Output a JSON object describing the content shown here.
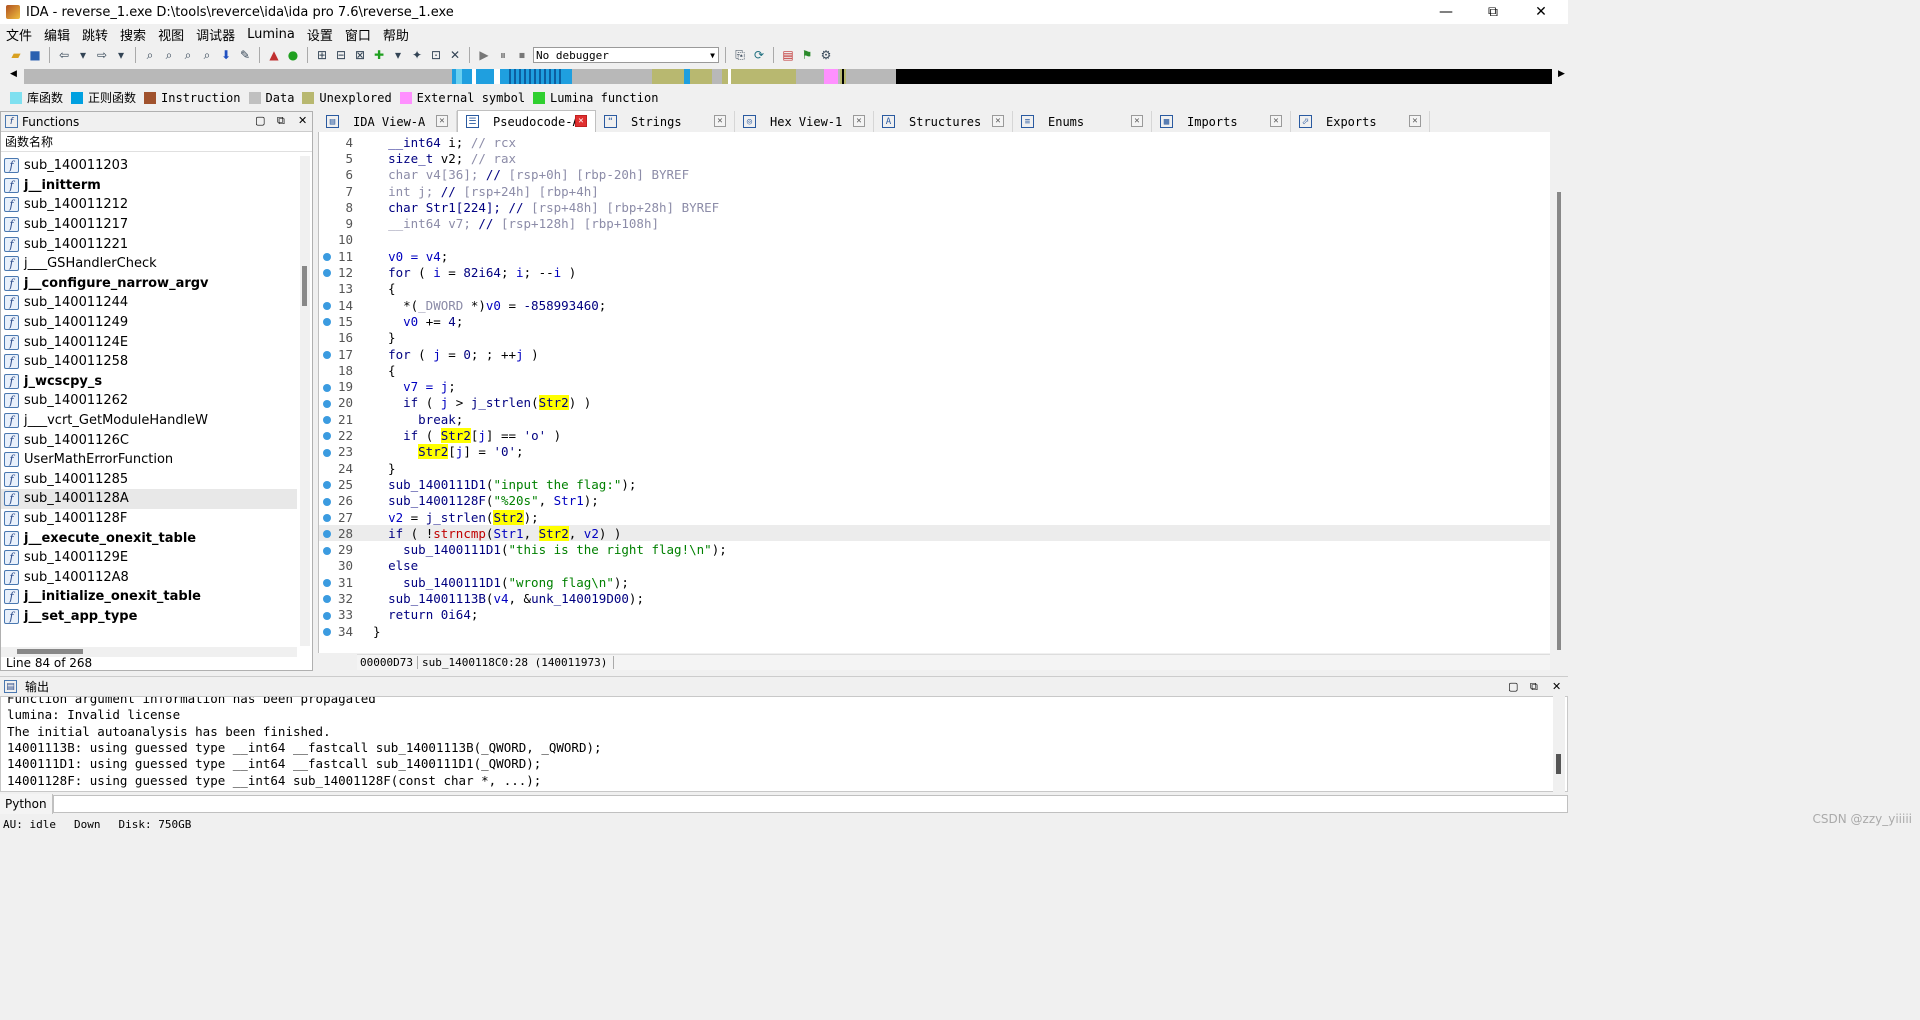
{
  "window": {
    "title": "IDA - reverse_1.exe D:\\tools\\reverce\\ida\\ida pro 7.6\\reverse_1.exe",
    "minimize": "—",
    "maximize": "⧉",
    "close": "✕"
  },
  "menu": [
    "文件",
    "编辑",
    "跳转",
    "搜索",
    "视图",
    "调试器",
    "Lumina",
    "设置",
    "窗口",
    "帮助"
  ],
  "toolbar": {
    "debugger_select": "No debugger"
  },
  "legend": [
    {
      "label": "库函数",
      "color": "#7fe0f0"
    },
    {
      "label": "正则函数",
      "color": "#00a0e0"
    },
    {
      "label": "Instruction",
      "color": "#a0522d"
    },
    {
      "label": "Data",
      "color": "#c0c0c0"
    },
    {
      "label": "Unexplored",
      "color": "#b8b870"
    },
    {
      "label": "External symbol",
      "color": "#ff90ff"
    },
    {
      "label": "Lumina function",
      "color": "#30d030"
    }
  ],
  "functions": {
    "title": "Functions",
    "column": "函数名称",
    "items": [
      {
        "name": "sub_140011203",
        "bold": false
      },
      {
        "name": "j__initterm",
        "bold": true
      },
      {
        "name": "sub_140011212",
        "bold": false
      },
      {
        "name": "sub_140011217",
        "bold": false
      },
      {
        "name": "sub_140011221",
        "bold": false
      },
      {
        "name": "j___GSHandlerCheck",
        "bold": false
      },
      {
        "name": "j__configure_narrow_argv",
        "bold": true
      },
      {
        "name": "sub_140011244",
        "bold": false
      },
      {
        "name": "sub_140011249",
        "bold": false
      },
      {
        "name": "sub_14001124E",
        "bold": false
      },
      {
        "name": "sub_140011258",
        "bold": false
      },
      {
        "name": "j_wcscpy_s",
        "bold": true
      },
      {
        "name": "sub_140011262",
        "bold": false
      },
      {
        "name": "j___vcrt_GetModuleHandleW",
        "bold": false
      },
      {
        "name": "sub_14001126C",
        "bold": false
      },
      {
        "name": "UserMathErrorFunction",
        "bold": false
      },
      {
        "name": "sub_140011285",
        "bold": false
      },
      {
        "name": "sub_14001128A",
        "bold": false,
        "selected": true
      },
      {
        "name": "sub_14001128F",
        "bold": false
      },
      {
        "name": "j__execute_onexit_table",
        "bold": true
      },
      {
        "name": "sub_14001129E",
        "bold": false
      },
      {
        "name": "sub_1400112A8",
        "bold": false
      },
      {
        "name": "j__initialize_onexit_table",
        "bold": true
      },
      {
        "name": "j__set_app_type",
        "bold": true
      }
    ],
    "status": "Line 84 of 268"
  },
  "tabs": [
    {
      "label": "IDA View-A",
      "icon": "▤",
      "active": false
    },
    {
      "label": "Pseudocode-A",
      "icon": "☰",
      "active": true
    },
    {
      "label": "Strings",
      "icon": "❝",
      "active": false
    },
    {
      "label": "Hex View-1",
      "icon": "◎",
      "active": false
    },
    {
      "label": "Structures",
      "icon": "A",
      "active": false
    },
    {
      "label": "Enums",
      "icon": "≡",
      "active": false
    },
    {
      "label": "Imports",
      "icon": "▦",
      "active": false
    },
    {
      "label": "Exports",
      "icon": "⬀",
      "active": false
    }
  ],
  "code": {
    "lines": [
      {
        "n": "4",
        "dot": false,
        "html": "  <span class='kw'>__int64</span> i; <span class='cm'>// </span><span class='cm'>rcx</span>"
      },
      {
        "n": "5",
        "dot": false,
        "html": "  <span class='kw'>size_t</span> v2; <span class='cm'>// rax</span>"
      },
      {
        "n": "6",
        "dot": false,
        "html": "  <span class='cm'>char v4[36]; </span><span class='kw'>// </span><span class='cm'>[rsp+0h] [rbp-20h] BYREF</span>"
      },
      {
        "n": "7",
        "dot": false,
        "html": "  <span class='cm'>int j; </span><span class='kw'>// </span><span class='cm'>[rsp+24h] [rbp+4h]</span>"
      },
      {
        "n": "8",
        "dot": false,
        "html": "  <span class='kw'>char Str1[224]; // </span><span class='cm'>[rsp+48h] [rbp+28h] BYREF</span>"
      },
      {
        "n": "9",
        "dot": false,
        "html": "  <span class='cm'>__int64 v7; </span><span class='kw'>// </span><span class='cm'>[rsp+128h] [rbp+108h]</span>"
      },
      {
        "n": "10",
        "dot": false,
        "html": ""
      },
      {
        "n": "11",
        "dot": true,
        "html": "  <span class='vr'>v0 = v4</span>;"
      },
      {
        "n": "12",
        "dot": true,
        "html": "  <span class='kw'>for</span> ( <span class='vr'>i</span> = <span class='nm2'>82i64</span>; <span class='vr'>i</span>; --<span class='vr'>i</span> )"
      },
      {
        "n": "13",
        "dot": false,
        "html": "  {"
      },
      {
        "n": "14",
        "dot": true,
        "html": "    *(<span class='cm'>_DWORD</span> *)<span class='vr'>v0</span> = <span class='nm2'>-858993460</span>;"
      },
      {
        "n": "15",
        "dot": true,
        "html": "    <span class='vr'>v0</span> += <span class='nm2'>4</span>;"
      },
      {
        "n": "16",
        "dot": false,
        "html": "  }"
      },
      {
        "n": "17",
        "dot": true,
        "html": "  <span class='kw'>for</span> ( <span class='vr'>j</span> = <span class='nm2'>0</span>; ; ++<span class='vr'>j</span> )"
      },
      {
        "n": "18",
        "dot": false,
        "html": "  {"
      },
      {
        "n": "19",
        "dot": true,
        "html": "    <span class='vr'>v7 = j</span>;"
      },
      {
        "n": "20",
        "dot": true,
        "html": "    <span class='kw'>if</span> ( <span class='vr'>j</span> &gt; <span class='kw'>j_strlen</span>(<span class='hl kw'>Str2</span>) )"
      },
      {
        "n": "21",
        "dot": true,
        "html": "      <span class='kw'>break</span>;"
      },
      {
        "n": "22",
        "dot": true,
        "html": "    <span class='kw'>if</span> ( <span class='hl kw'>Str2</span>[<span class='vr'>j</span>] == <span class='nm2'>'o'</span> )"
      },
      {
        "n": "23",
        "dot": true,
        "html": "      <span class='hl kw'>Str2</span>[<span class='vr'>j</span>] = <span class='nm2'>'0'</span>;"
      },
      {
        "n": "24",
        "dot": false,
        "html": "  }"
      },
      {
        "n": "25",
        "dot": true,
        "html": "  <span class='kw'>sub_1400111D1</span>(<span class='st'>\"input the flag:\"</span>);"
      },
      {
        "n": "26",
        "dot": true,
        "html": "  <span class='kw'>sub_14001128F</span>(<span class='st'>\"%20s\"</span>, <span class='vr'>Str1</span>);"
      },
      {
        "n": "27",
        "dot": true,
        "html": "  <span class='vr'>v2</span> = <span class='kw'>j_strlen</span>(<span class='hl kw'>Str2</span>);"
      },
      {
        "n": "28",
        "dot": true,
        "cur": true,
        "html": "  <span class='kw'>if</span> ( !<span class='red'>strncmp</span>(<span class='vr'>Str1</span>, <span class='hl kw'>Str2</span>, <span class='vr'>v2</span>) )"
      },
      {
        "n": "29",
        "dot": true,
        "html": "    <span class='kw'>sub_1400111D1</span>(<span class='st'>\"this is the right flag!\\n\"</span>);"
      },
      {
        "n": "30",
        "dot": false,
        "html": "  <span class='kw'>else</span>"
      },
      {
        "n": "31",
        "dot": true,
        "html": "    <span class='kw'>sub_1400111D1</span>(<span class='st'>\"wrong flag\\n\"</span>);"
      },
      {
        "n": "32",
        "dot": true,
        "html": "  <span class='kw'>sub_14001113B</span>(<span class='vr'>v4</span>, &amp;<span class='kw'>unk_140019D00</span>);"
      },
      {
        "n": "33",
        "dot": true,
        "html": "  <span class='kw'>return</span> <span class='nm2'>0i64</span>;"
      },
      {
        "n": "34",
        "dot": true,
        "html": "}"
      }
    ],
    "status_addr": "00000D73",
    "status_loc": "sub_1400118C0:28 (140011973)"
  },
  "output": {
    "title": "输出",
    "lines": [
      "Function argument information has been propagated",
      "lumina: Invalid license",
      "The initial autoanalysis has been finished.",
      "14001113B: using guessed type __int64 __fastcall sub_14001113B(_QWORD, _QWORD);",
      "1400111D1: using guessed type __int64 __fastcall sub_1400111D1(_QWORD);",
      "14001128F: using guessed type __int64 sub_14001128F(const char *, ...);"
    ]
  },
  "python_label": "Python",
  "statusbar": {
    "au": "AU:  idle",
    "dir": "Down",
    "disk": "Disk: 750GB"
  },
  "watermark": "CSDN @zzy_yiiiii"
}
